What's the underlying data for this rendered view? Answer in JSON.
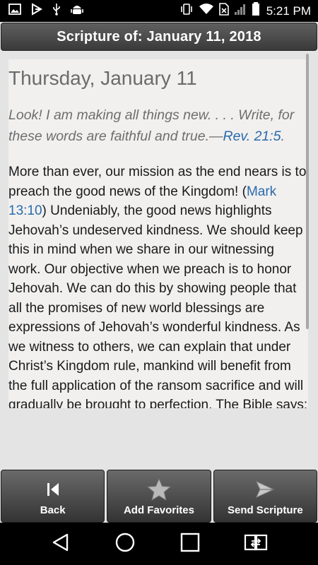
{
  "status_bar": {
    "left_icons": [
      "gallery-icon",
      "download-icon",
      "usb-icon",
      "android-debug-icon"
    ],
    "right_icons": [
      "vibrate-icon",
      "wifi-icon",
      "no-sim-icon",
      "signal-icon",
      "battery-icon"
    ],
    "time": "5:21 PM"
  },
  "header": {
    "title": "Scripture of: January 11, 2018"
  },
  "scripture": {
    "day_title": "Thursday, January 11",
    "verse_text": "Look! I am making all things new. . . . Write, for these words are faithful and true.—",
    "verse_ref": "Rev. 21:5",
    "verse_end": ".",
    "para_part1": "More than ever, our mission as the end nears is to preach the good news of the Kingdom! (",
    "para_link": "Mark 13:10",
    "para_part2": ") Undeniably, the good news highlights Jehovah’s undeserved kindness. We should keep this in mind when we share in our witnessing work. Our objective when we preach is to honor Jehovah. We can do this by showing people that all the promises of new world blessings are expressions of Jehovah’s wonderful kindness. As we witness to others, we can explain that under Christ’s Kingdom rule, mankind will benefit from the full application of the ransom sacrifice and will gradually be brought to perfection. The Bible says: “The creation itself will"
  },
  "buttons": {
    "back": {
      "label": "Back",
      "icon": "skip-back-icon"
    },
    "favorites": {
      "label": "Add Favorites",
      "icon": "star-icon"
    },
    "send": {
      "label": "Send Scripture",
      "icon": "send-icon"
    }
  },
  "nav": {
    "back": "nav-back-icon",
    "home": "nav-home-icon",
    "recents": "nav-recents-icon",
    "switch": "nav-switch-icon"
  },
  "colors": {
    "link": "#2a6aab",
    "header_bg": "#4a4a4a",
    "content_bg": "#f1f0ef"
  }
}
